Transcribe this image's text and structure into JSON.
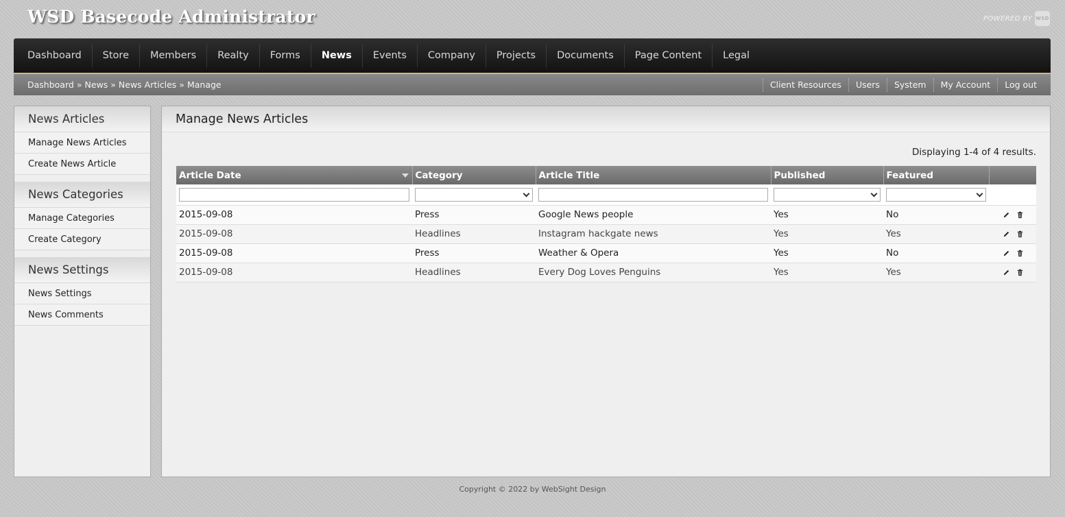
{
  "app": {
    "title": "WSD Basecode Administrator",
    "powered_by": "POWERED BY",
    "powered_logo": "WSD"
  },
  "main_nav": [
    {
      "label": "Dashboard",
      "active": false
    },
    {
      "label": "Store",
      "active": false
    },
    {
      "label": "Members",
      "active": false
    },
    {
      "label": "Realty",
      "active": false
    },
    {
      "label": "Forms",
      "active": false
    },
    {
      "label": "News",
      "active": true
    },
    {
      "label": "Events",
      "active": false
    },
    {
      "label": "Company",
      "active": false
    },
    {
      "label": "Projects",
      "active": false
    },
    {
      "label": "Documents",
      "active": false
    },
    {
      "label": "Page Content",
      "active": false
    },
    {
      "label": "Legal",
      "active": false
    }
  ],
  "breadcrumb": {
    "items": [
      "Dashboard",
      "News",
      "News Articles",
      "Manage"
    ],
    "separator": "»"
  },
  "util_links": [
    "Client Resources",
    "Users",
    "System",
    "My Account",
    "Log out"
  ],
  "sidebar": {
    "groups": [
      {
        "title": "News Articles",
        "items": [
          "Manage News Articles",
          "Create News Article"
        ]
      },
      {
        "title": "News Categories",
        "items": [
          "Manage Categories",
          "Create Category"
        ]
      },
      {
        "title": "News Settings",
        "items": [
          "News Settings",
          "News Comments"
        ]
      }
    ]
  },
  "content": {
    "title": "Manage News Articles",
    "summary": "Displaying 1-4 of 4 results.",
    "columns": [
      "Article Date",
      "Category",
      "Article Title",
      "Published",
      "Featured",
      ""
    ],
    "sorted_column": "Article Date",
    "filters": {
      "article_date": "",
      "category": "",
      "article_title": "",
      "published": "",
      "featured": ""
    },
    "rows": [
      {
        "date": "2015-09-08",
        "category": "Press",
        "title": "Google News people",
        "published": "Yes",
        "featured": "No"
      },
      {
        "date": "2015-09-08",
        "category": "Headlines",
        "title": "Instagram hackgate news",
        "published": "Yes",
        "featured": "Yes"
      },
      {
        "date": "2015-09-08",
        "category": "Press",
        "title": "Weather & Opera",
        "published": "Yes",
        "featured": "No"
      },
      {
        "date": "2015-09-08",
        "category": "Headlines",
        "title": "Every Dog Loves Penguins",
        "published": "Yes",
        "featured": "Yes"
      }
    ],
    "row_actions": [
      "edit-icon",
      "delete-icon"
    ]
  },
  "footer": {
    "copyright": "Copyright © 2022 by WebSight Design"
  }
}
